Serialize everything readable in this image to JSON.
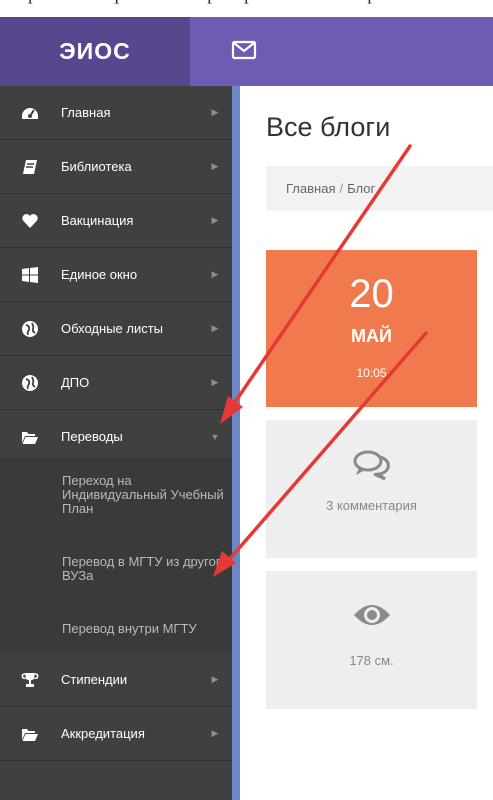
{
  "header": {
    "brand": "ЭИОС",
    "mail_icon": "envelope-icon"
  },
  "colors": {
    "header": "#6f5bb3",
    "brand_bg": "#58468f",
    "sidebar": "#404040",
    "sidebar_edge": "#6b87c6",
    "date_box": "#f07a4d",
    "stat_box": "#eeeeee",
    "annotation_arrow": "#e53935"
  },
  "sidebar": {
    "items": [
      {
        "label": "Главная",
        "icon": "dashboard-icon"
      },
      {
        "label": "Библиотека",
        "icon": "book-icon"
      },
      {
        "label": "Вакцинация",
        "icon": "heart-icon"
      },
      {
        "label": "Единое окно",
        "icon": "windows-icon"
      },
      {
        "label": "Обходные листы",
        "icon": "globe-icon"
      },
      {
        "label": "ДПО",
        "icon": "globe-icon"
      },
      {
        "label": "Переводы",
        "icon": "folder-open-icon",
        "expanded": true
      },
      {
        "label": "Стипендии",
        "icon": "trophy-icon"
      },
      {
        "label": "Аккредитация",
        "icon": "folder-open-icon"
      }
    ],
    "submenu": [
      {
        "label": "Переход на Индивидуальный Учебный План"
      },
      {
        "label": "Перевод в МГТУ из другого ВУЗа"
      },
      {
        "label": "Перевод внутри МГТУ"
      }
    ]
  },
  "main": {
    "title": "Все блоги",
    "breadcrumb": [
      "Главная",
      "Блог"
    ],
    "post": {
      "day": "20",
      "month": "МАЙ",
      "time": "10:05",
      "comments": "3 комментария",
      "views": "178 см."
    }
  }
}
